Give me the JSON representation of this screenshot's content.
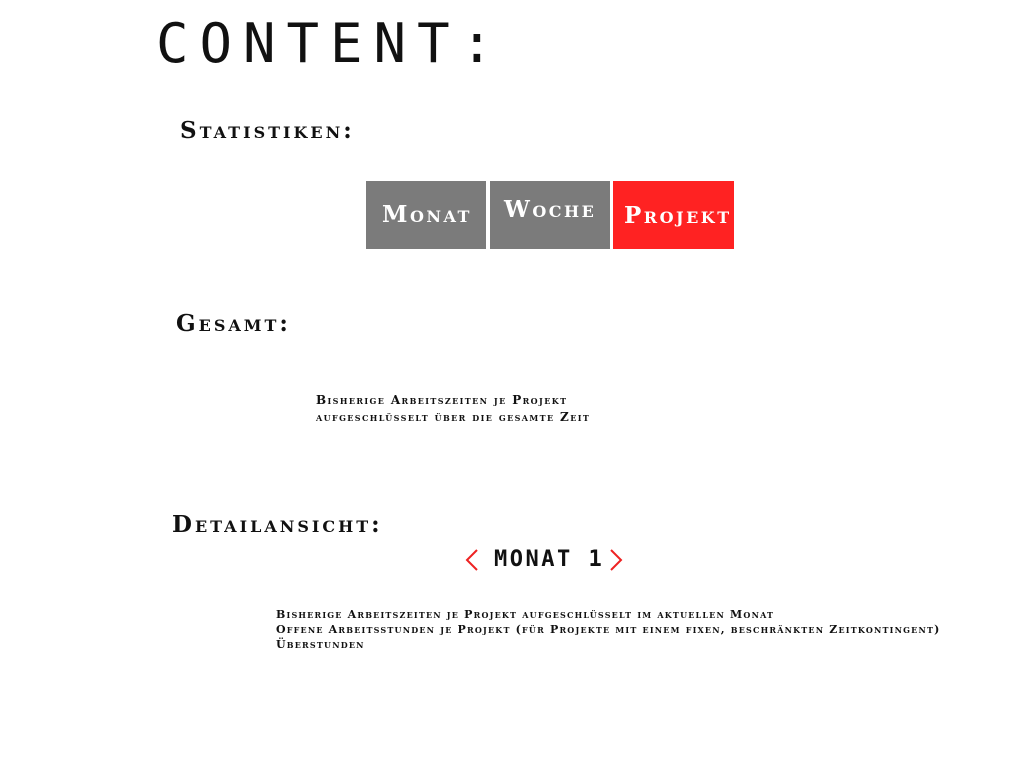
{
  "page": {
    "title": "CONTENT:"
  },
  "statistics": {
    "heading": "Statistiken:",
    "tabs": [
      {
        "label": "Monat",
        "active": false,
        "color": "#7b7b7b"
      },
      {
        "label": "Woche",
        "active": false,
        "color": "#7b7b7b"
      },
      {
        "label": "Projekt",
        "active": true,
        "color": "#ff2222"
      }
    ]
  },
  "total": {
    "heading": "Gesamt:",
    "description": [
      "Bisherige Arbeitszeiten je Projekt",
      "aufgeschlüsselt über die gesamte Zeit"
    ]
  },
  "detail": {
    "heading": "Detailansicht:",
    "navigator": {
      "label": "MONAT 1",
      "prev_icon": "chevron-left-icon",
      "next_icon": "chevron-right-icon",
      "arrow_color": "#ee2222"
    },
    "description": [
      "Bisherige Arbeitszeiten je Projekt aufgeschlüsselt im aktuellen Monat",
      "Offene Arbeitsstunden je Projekt (für Projekte mit einem fixen, beschränkten Zeitkontingent)",
      "Überstunden"
    ]
  }
}
